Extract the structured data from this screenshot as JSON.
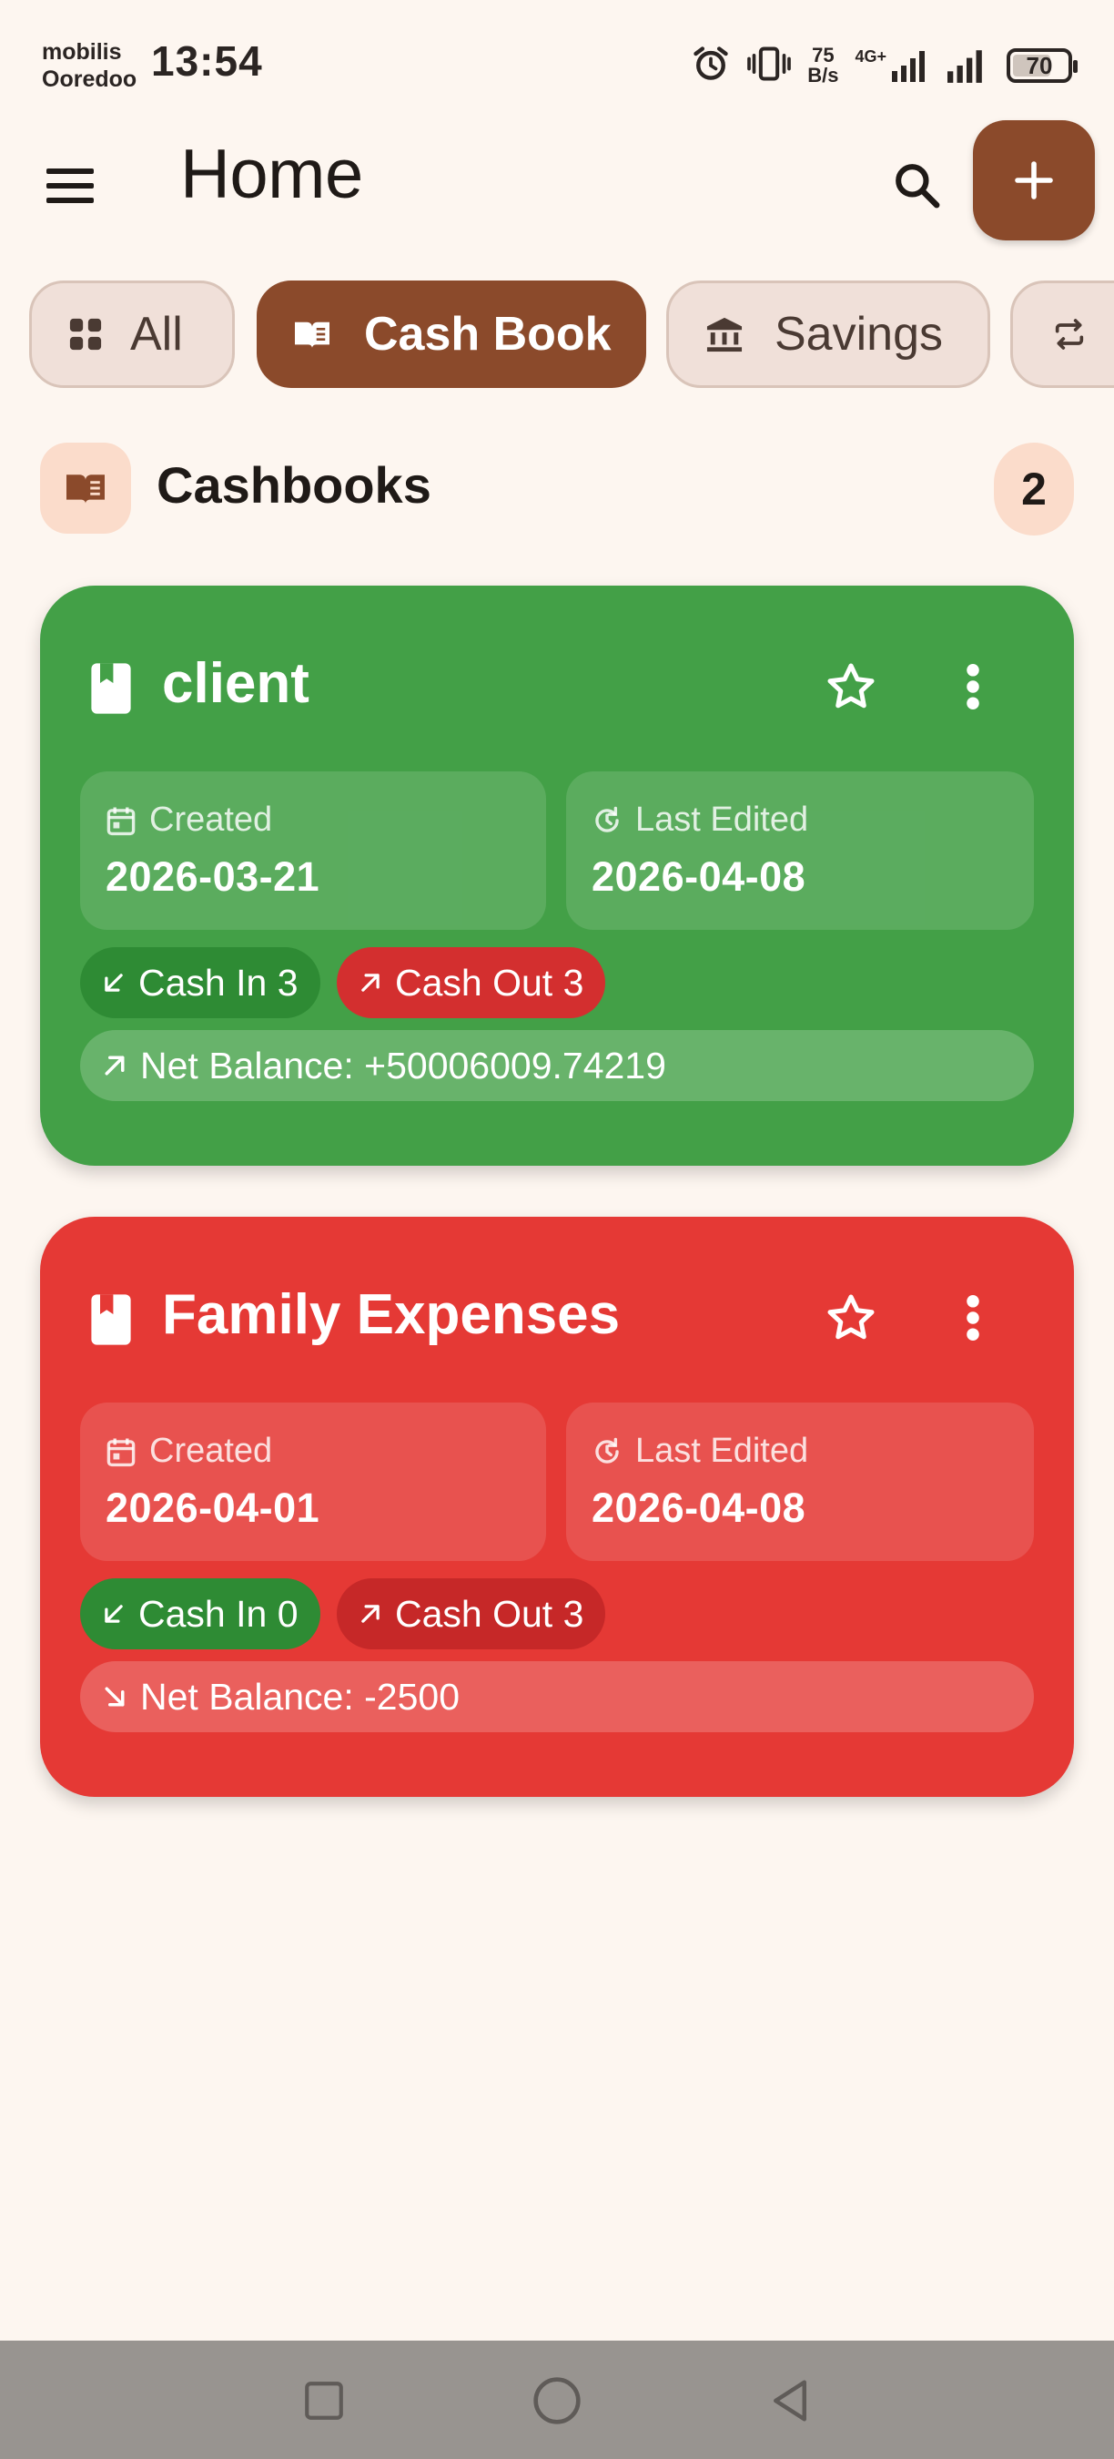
{
  "status_bar": {
    "carrier_line1": "mobilis",
    "carrier_line2": "Ooredoo",
    "time": "13:54",
    "net_speed_value": "75",
    "net_speed_unit": "B/s",
    "network_type": "4G+",
    "battery_level": "70",
    "battery_fraction": 0.7
  },
  "app_bar": {
    "title": "Home",
    "menu_icon": "hamburger-menu-icon",
    "search_icon": "search-icon",
    "add_icon": "plus-icon"
  },
  "filters": [
    {
      "label": "All",
      "icon": "grid-icon",
      "active": false
    },
    {
      "label": "Cash Book",
      "icon": "book-open-icon",
      "active": true
    },
    {
      "label": "Savings",
      "icon": "bank-icon",
      "active": false
    },
    {
      "label": "",
      "icon": "repeat-icon",
      "active": false
    }
  ],
  "section": {
    "title": "Cashbooks",
    "count": "2"
  },
  "cards": [
    {
      "name": "client",
      "color": "#43A047",
      "created_label": "Created",
      "created_value": "2026-03-21",
      "edited_label": "Last Edited",
      "edited_value": "2026-04-08",
      "cash_in": "Cash In 3",
      "cash_out": "Cash Out 3",
      "net_balance": "Net Balance: +50006009.74219"
    },
    {
      "name": "Family Expenses",
      "color": "#E53935",
      "created_label": "Created",
      "created_value": "2026-04-01",
      "edited_label": "Last Edited",
      "edited_value": "2026-04-08",
      "cash_in": "Cash In 0",
      "cash_out": "Cash Out 3",
      "net_balance": "Net Balance: -2500"
    }
  ],
  "colors": {
    "background": "#FDF6F0",
    "accent_brown": "#8B4A2B",
    "chip_inactive": "#F0E0D9",
    "section_badge": "#FBDCCB",
    "cash_in_pill": "#2E8B34",
    "cash_out_pill": "#C62828"
  }
}
